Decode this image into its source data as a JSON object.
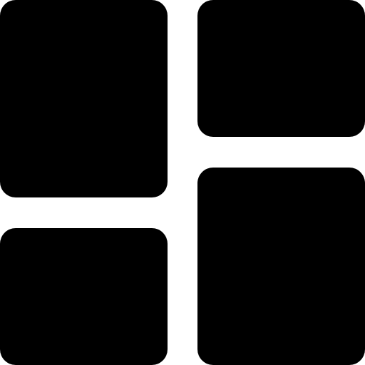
{
  "icon": {
    "name": "dashboard-layout-icon",
    "color": "#000000",
    "background": "#ffffff",
    "tiles": [
      {
        "name": "top-left-tile"
      },
      {
        "name": "top-right-tile"
      },
      {
        "name": "bottom-left-tile"
      },
      {
        "name": "bottom-right-tile"
      }
    ]
  }
}
